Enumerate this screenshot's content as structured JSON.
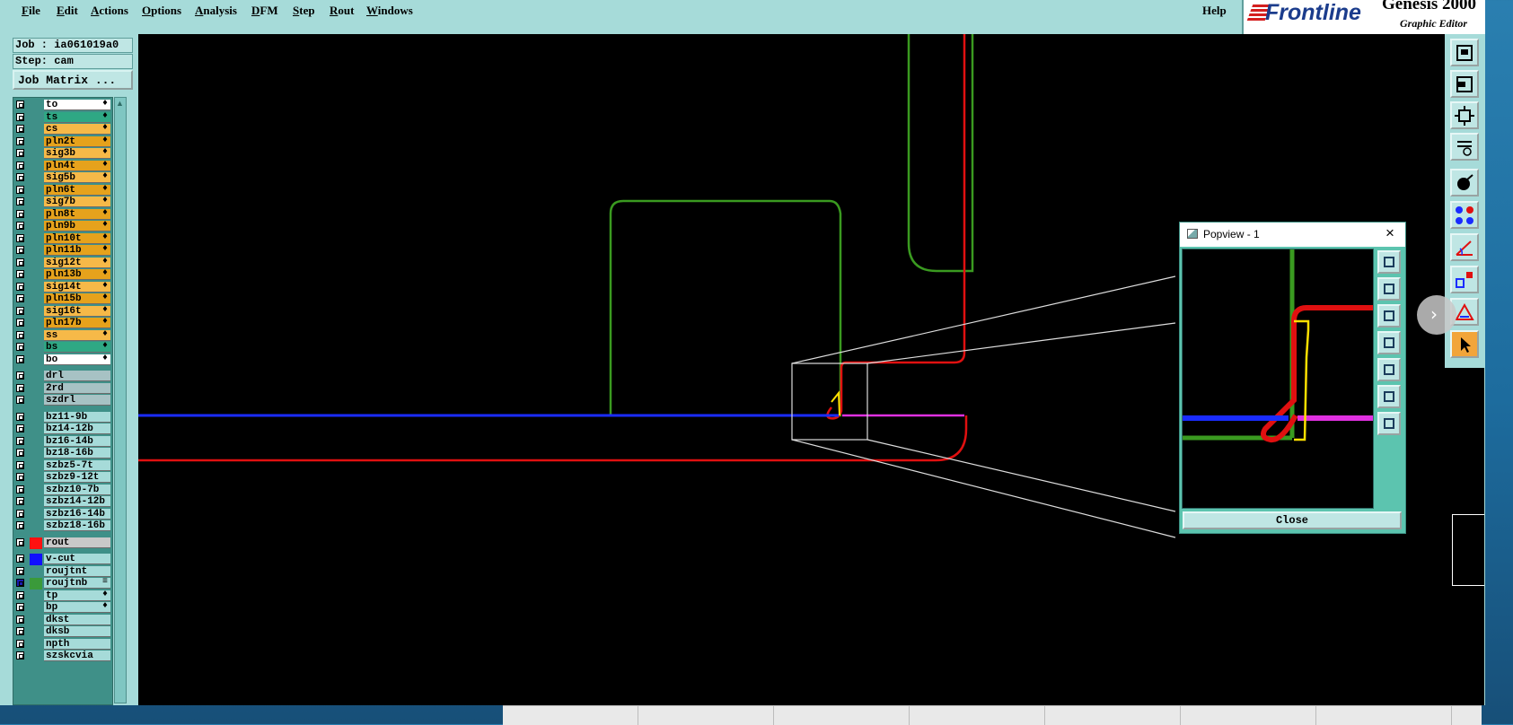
{
  "menubar": {
    "items": [
      "File",
      "Edit",
      "Actions",
      "Options",
      "Analysis",
      "DFM",
      "Step",
      "Rout",
      "Windows"
    ],
    "help": "Help"
  },
  "brand": {
    "logo": "Frontline",
    "product": "Genesis 2000",
    "subtitle": "Graphic Editor"
  },
  "job": {
    "job_line": "Job : ia061019a0",
    "step_line": "Step: cam",
    "matrix_button": "Job Matrix ..."
  },
  "layers": [
    {
      "name": "to",
      "bg": "#ffffff",
      "mark": "♦"
    },
    {
      "name": "ts",
      "bg": "#2fa884",
      "mark": "♦"
    },
    {
      "name": "cs",
      "bg": "#f6b948",
      "mark": "♦"
    },
    {
      "name": "pln2t",
      "bg": "#e6a21c",
      "mark": "♦"
    },
    {
      "name": "sig3b",
      "bg": "#f6b948",
      "mark": "♦"
    },
    {
      "name": "pln4t",
      "bg": "#e6a21c",
      "mark": "♦"
    },
    {
      "name": "sig5b",
      "bg": "#f6b948",
      "mark": "♦"
    },
    {
      "name": "pln6t",
      "bg": "#e6a21c",
      "mark": "♦"
    },
    {
      "name": "sig7b",
      "bg": "#f6b948",
      "mark": "♦"
    },
    {
      "name": "pln8t",
      "bg": "#e6a21c",
      "mark": "♦"
    },
    {
      "name": "pln9b",
      "bg": "#e6a21c",
      "mark": "♦"
    },
    {
      "name": "pln10t",
      "bg": "#e6a21c",
      "mark": "♦"
    },
    {
      "name": "pln11b",
      "bg": "#e6a21c",
      "mark": "♦"
    },
    {
      "name": "sig12t",
      "bg": "#f6b948",
      "mark": "♦"
    },
    {
      "name": "pln13b",
      "bg": "#e6a21c",
      "mark": "♦"
    },
    {
      "name": "sig14t",
      "bg": "#f6b948",
      "mark": "♦"
    },
    {
      "name": "pln15b",
      "bg": "#e6a21c",
      "mark": "♦"
    },
    {
      "name": "sig16t",
      "bg": "#f6b948",
      "mark": "♦"
    },
    {
      "name": "pln17b",
      "bg": "#e6a21c",
      "mark": "♦"
    },
    {
      "name": "ss",
      "bg": "#f6b948",
      "mark": "♦"
    },
    {
      "name": "bs",
      "bg": "#2fa884",
      "mark": "♦"
    },
    {
      "name": "bo",
      "bg": "#ffffff",
      "mark": "♦"
    },
    {
      "gap": true
    },
    {
      "name": "drl",
      "bg": "#a7c2c4",
      "mark": ""
    },
    {
      "name": "2rd",
      "bg": "#a7c2c4",
      "mark": ""
    },
    {
      "name": "szdrl",
      "bg": "#a7c2c4",
      "mark": ""
    },
    {
      "gap": true
    },
    {
      "name": "bz11-9b",
      "bg": "#a6dbd9",
      "mark": ""
    },
    {
      "name": "bz14-12b",
      "bg": "#a6dbd9",
      "mark": ""
    },
    {
      "name": "bz16-14b",
      "bg": "#a6dbd9",
      "mark": ""
    },
    {
      "name": "bz18-16b",
      "bg": "#a6dbd9",
      "mark": ""
    },
    {
      "name": "szbz5-7t",
      "bg": "#a6dbd9",
      "mark": ""
    },
    {
      "name": "szbz9-12t",
      "bg": "#a6dbd9",
      "mark": ""
    },
    {
      "name": "szbz10-7b",
      "bg": "#a6dbd9",
      "mark": ""
    },
    {
      "name": "szbz14-12b",
      "bg": "#a6dbd9",
      "mark": ""
    },
    {
      "name": "szbz16-14b",
      "bg": "#a6dbd9",
      "mark": ""
    },
    {
      "name": "szbz18-16b",
      "bg": "#a6dbd9",
      "mark": ""
    },
    {
      "gap": true
    },
    {
      "name": "rout",
      "bg": "#c9c9c9",
      "mark": "",
      "swatch": "#ff1010"
    },
    {
      "gap": true
    },
    {
      "name": "v-cut",
      "bg": "#a6dbd9",
      "mark": "",
      "swatch": "#1010ff"
    },
    {
      "name": "roujtnt",
      "bg": "#a6dbd9",
      "mark": ""
    },
    {
      "name": "roujtnb",
      "bg": "#a6dbd9",
      "mark": "≡",
      "swatch": "#3a9a3a",
      "on": true
    },
    {
      "name": "tp",
      "bg": "#a6dbd9",
      "mark": "♦"
    },
    {
      "name": "bp",
      "bg": "#a6dbd9",
      "mark": "♦"
    },
    {
      "name": "dkst",
      "bg": "#a6dbd9",
      "mark": ""
    },
    {
      "name": "dksb",
      "bg": "#a6dbd9",
      "mark": ""
    },
    {
      "name": "npth",
      "bg": "#a6dbd9",
      "mark": ""
    },
    {
      "name": "szskcvia",
      "bg": "#a6dbd9",
      "mark": ""
    }
  ],
  "popview": {
    "title": "Popview - 1",
    "close_x": "×",
    "close_button": "Close"
  },
  "colors": {
    "canvas": "#000000",
    "panel": "#a6dbd9",
    "green_layer": "#3a9a20",
    "red_layer": "#e01010",
    "blue_layer": "#1a2cff",
    "magenta_layer": "#e030e0",
    "yellow_layer": "#ffe000",
    "accent_brand": "#1b3c8c"
  },
  "right_toolbar_icons": [
    "home-icon",
    "zoom-back-icon",
    "fit-icon",
    "settings-icon",
    "snap-icon",
    "nodes-icon",
    "measure-icon",
    "select-icon",
    "triangle-icon",
    "pointer-icon"
  ],
  "chevron": "›"
}
